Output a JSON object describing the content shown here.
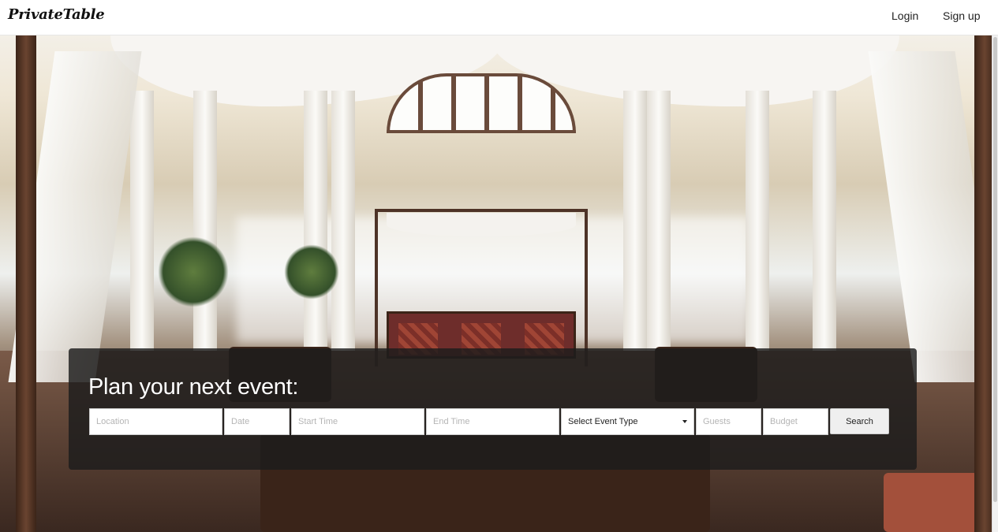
{
  "header": {
    "brand": "PrivateTable",
    "login_label": "Login",
    "signup_label": "Sign up"
  },
  "search_panel": {
    "title": "Plan your next event:",
    "location_placeholder": "Location",
    "date_placeholder": "Date",
    "start_time_placeholder": "Start Time",
    "end_time_placeholder": "End Time",
    "event_type_selected": "Select Event Type",
    "guests_placeholder": "Guests",
    "budget_placeholder": "Budget",
    "search_label": "Search"
  },
  "hero": {
    "image_icon": "venue-lobby-photo"
  },
  "colors": {
    "panel_background": "#1c1c1c",
    "panel_text": "#ffffff",
    "button_background": "#efefef"
  }
}
